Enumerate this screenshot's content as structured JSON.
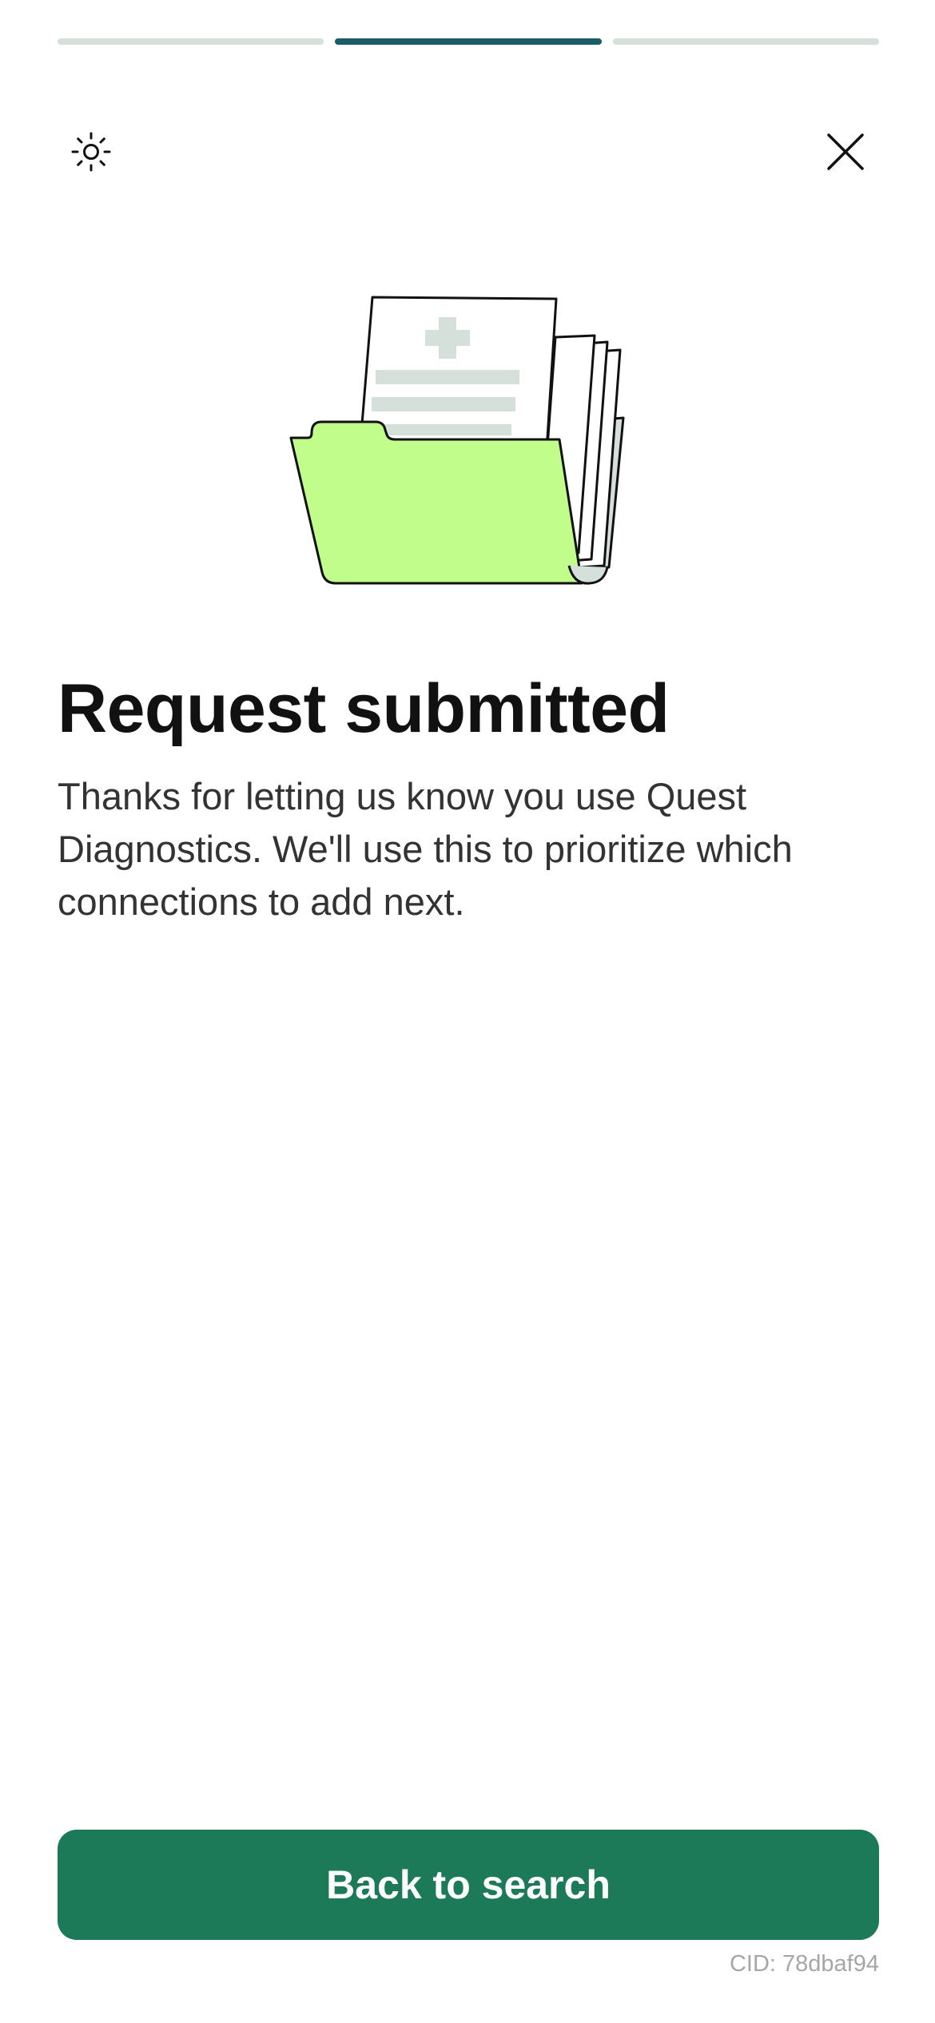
{
  "progress": {
    "total_steps": 3,
    "active_step": 2
  },
  "header": {
    "theme_icon": "sun-icon",
    "close_icon": "close-icon"
  },
  "illustration": {
    "icon": "medical-records-folder-illustration",
    "colors": {
      "folder": "#c1fd8b",
      "paper_accent": "#d5e0da",
      "outline": "#111111"
    }
  },
  "content": {
    "title": "Request submitted",
    "message": "Thanks for letting us know you use Quest Diagnostics. We'll use this to prioritize which connections to add next."
  },
  "actions": {
    "back_label": "Back to search"
  },
  "footer": {
    "cid": "CID: 78dbaf94"
  },
  "colors": {
    "accent": "#1c7a59",
    "progress_active": "#1b5c68",
    "progress_inactive": "#d5e0da"
  }
}
